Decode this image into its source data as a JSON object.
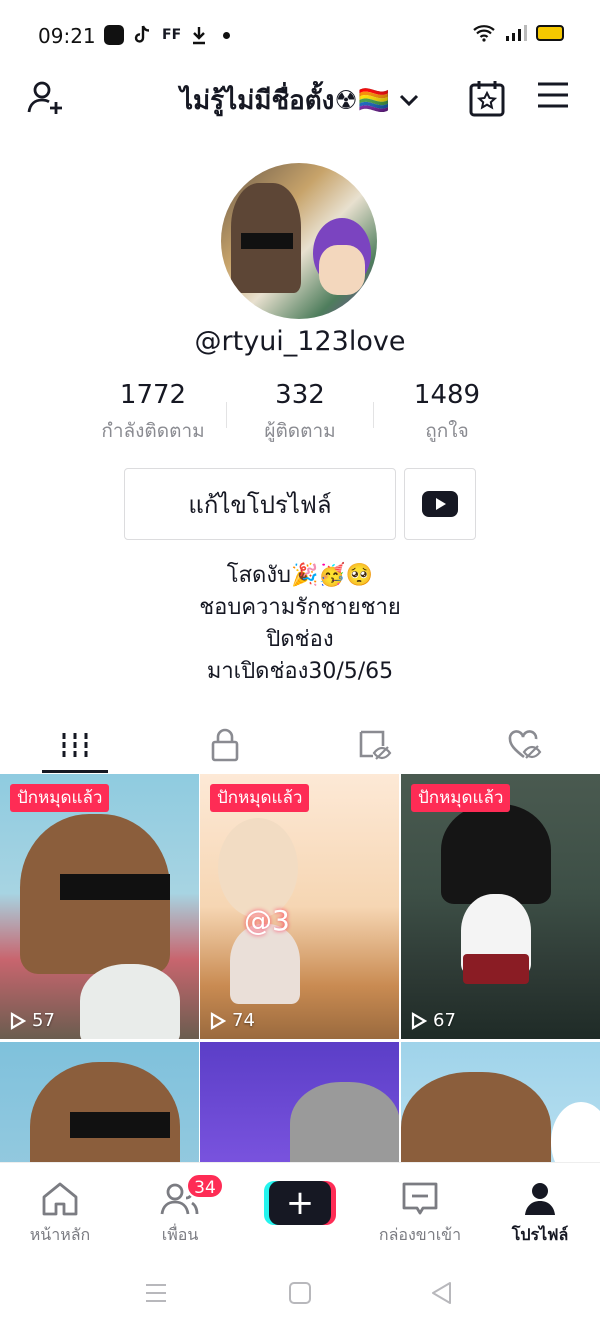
{
  "status_bar": {
    "time": "09:21",
    "left_icons": [
      "app-icon",
      "tiktok-icon",
      "ff-icon",
      "download-icon",
      "dot-icon"
    ],
    "ff_text": "FF",
    "right_icons": [
      "wifi-icon",
      "signal-icon",
      "battery-icon"
    ]
  },
  "header": {
    "account_name": "ไม่รู้ไม่มีชื่อตั้ง☢🏳️‍🌈",
    "icons": [
      "add-user-icon",
      "chevron-down-icon",
      "calendar-icon",
      "menu-icon"
    ]
  },
  "profile": {
    "username": "@rtyui_123love",
    "stats": [
      {
        "value": "1772",
        "label": "กำลังติดตาม"
      },
      {
        "value": "332",
        "label": "ผู้ติดตาม"
      },
      {
        "value": "1489",
        "label": "ถูกใจ"
      }
    ],
    "edit_button_label": "แก้ไขโปรไฟล์",
    "bio_lines": [
      "โสดงับ🎉🥳🥺",
      "ชอบความรักชายชาย",
      "ปิดช่อง",
      "มาเปิดช่อง30/5/65"
    ]
  },
  "tabs": [
    "videos-grid-icon",
    "lock-icon",
    "hidden-likes-icon",
    "liked-hidden-icon"
  ],
  "videos": [
    {
      "pinned_label": "ปักหมุดแล้ว",
      "views": "57"
    },
    {
      "pinned_label": "ปักหมุดแล้ว",
      "views": "74"
    },
    {
      "pinned_label": "ปักหมุดแล้ว",
      "views": "67"
    },
    {
      "pinned_label": "",
      "views": ""
    },
    {
      "pinned_label": "",
      "views": ""
    },
    {
      "pinned_label": "",
      "views": ""
    }
  ],
  "video_overlay_text": "@3",
  "bottom_nav": {
    "home": "หน้าหลัก",
    "friends": "เพื่อน",
    "friends_badge": "34",
    "create": "+",
    "inbox": "กล่องขาเข้า",
    "profile": "โปรไฟล์"
  },
  "colors": {
    "accent": "#fe2c55",
    "cyan": "#25f4ee",
    "text": "#161823",
    "muted": "#8a8b91"
  }
}
